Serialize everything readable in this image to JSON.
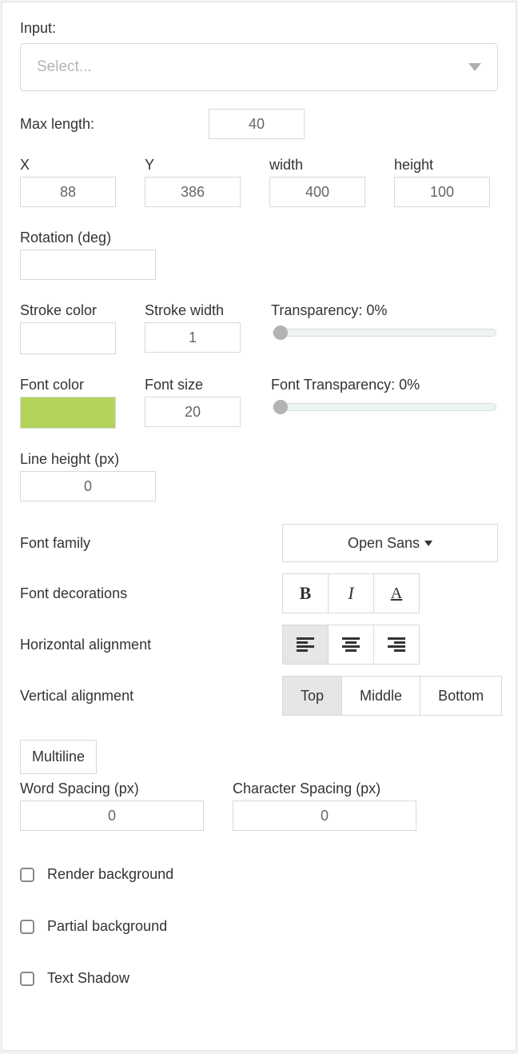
{
  "input": {
    "label": "Input:",
    "placeholder": "Select..."
  },
  "maxLength": {
    "label": "Max length:",
    "value": "40"
  },
  "dims": {
    "x": {
      "label": "X",
      "value": "88"
    },
    "y": {
      "label": "Y",
      "value": "386"
    },
    "width": {
      "label": "width",
      "value": "400"
    },
    "height": {
      "label": "height",
      "value": "100"
    }
  },
  "rotation": {
    "label": "Rotation (deg)",
    "value": ""
  },
  "strokeColor": {
    "label": "Stroke color",
    "value": ""
  },
  "strokeWidth": {
    "label": "Stroke width",
    "value": "1"
  },
  "transparency": {
    "label": "Transparency: 0%",
    "value": 0
  },
  "fontColor": {
    "label": "Font color",
    "value": "#b3d45a"
  },
  "fontSize": {
    "label": "Font size",
    "value": "20"
  },
  "fontTransparency": {
    "label": "Font Transparency: 0%",
    "value": 0
  },
  "lineHeight": {
    "label": "Line height (px)",
    "value": "0"
  },
  "fontFamily": {
    "label": "Font family",
    "selected": "Open Sans"
  },
  "fontDecorations": {
    "label": "Font decorations"
  },
  "hAlign": {
    "label": "Horizontal alignment",
    "options": [
      "left",
      "center",
      "right"
    ],
    "selected": "left"
  },
  "vAlign": {
    "label": "Vertical alignment",
    "options": {
      "top": "Top",
      "middle": "Middle",
      "bottom": "Bottom"
    },
    "selected": "top"
  },
  "multiline": {
    "label": "Multiline"
  },
  "wordSpacing": {
    "label": "Word Spacing (px)",
    "value": "0"
  },
  "charSpacing": {
    "label": "Character Spacing (px)",
    "value": "0"
  },
  "renderBg": {
    "label": "Render background",
    "checked": false
  },
  "partialBg": {
    "label": "Partial background",
    "checked": false
  },
  "textShadow": {
    "label": "Text Shadow",
    "checked": false
  }
}
